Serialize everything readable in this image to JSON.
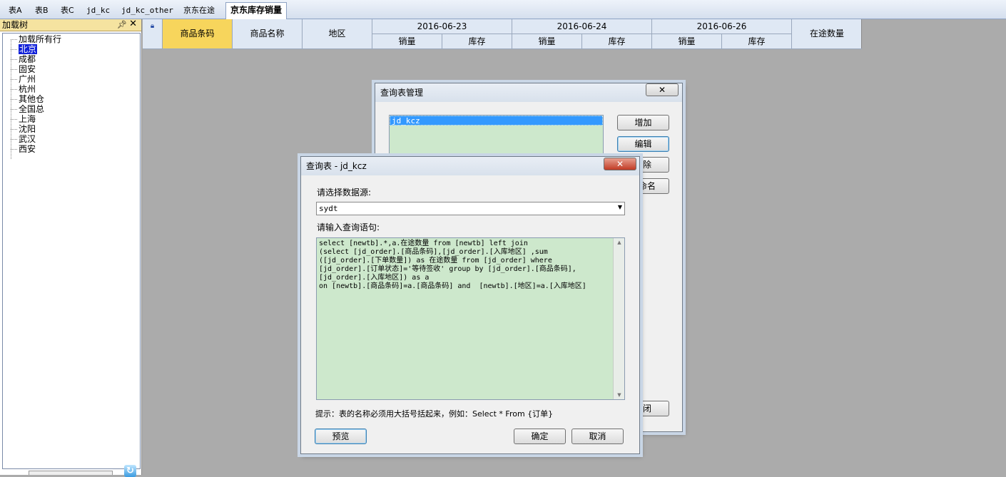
{
  "tabs": [
    "表A",
    "表B",
    "表C",
    "jd_kc",
    "jd_kc_other",
    "京东在途",
    "京东库存销量"
  ],
  "active_tab": "京东库存销量",
  "tree": {
    "header": "加载树",
    "items": [
      "加载所有行",
      "北京",
      "成都",
      "固安",
      "广州",
      "杭州",
      "其他仓",
      "全国总",
      "上海",
      "沈阳",
      "武汉",
      "西安"
    ],
    "selected": "北京"
  },
  "grid": {
    "columns": [
      "商品条码",
      "商品名称",
      "地区"
    ],
    "dates": [
      "2016-06-23",
      "2016-06-24",
      "2016-06-26"
    ],
    "sub_columns": [
      "销量",
      "库存"
    ],
    "last_column": "在途数量"
  },
  "manager_dialog": {
    "title": "查询表管理",
    "list_items": [
      "jd_kcz"
    ],
    "buttons": {
      "add": "增加",
      "edit": "编辑",
      "delete_partial": "除",
      "rename_partial": "命名",
      "close_partial": "闭"
    }
  },
  "query_dialog": {
    "title": "查询表 - jd_kcz",
    "datasource_label": "请选择数据源:",
    "datasource_value": "sydt",
    "query_label": "请输入查询语句:",
    "query_lines": [
      "select [newtb].*,a.在途数量 from [newtb] left join",
      "(select [jd_order].[商品条码],[jd_order].[入库地区] ,sum",
      "([jd_order].[下单数量]) as 在途数量 from [jd_order] where",
      "[jd_order].[订单状态]='等待签收' group by [jd_order].[商品条码],",
      "[jd_order].[入库地区]) as a",
      "on [newtb].[商品条码]=a.[商品条码] and  [newtb].[地区]=a.[入库地区]"
    ],
    "hint": "提示：表的名称必须用大括号括起来，例如：Select * From {订单}",
    "preview_label": "预览",
    "ok_label": "确定",
    "cancel_label": "取消"
  }
}
